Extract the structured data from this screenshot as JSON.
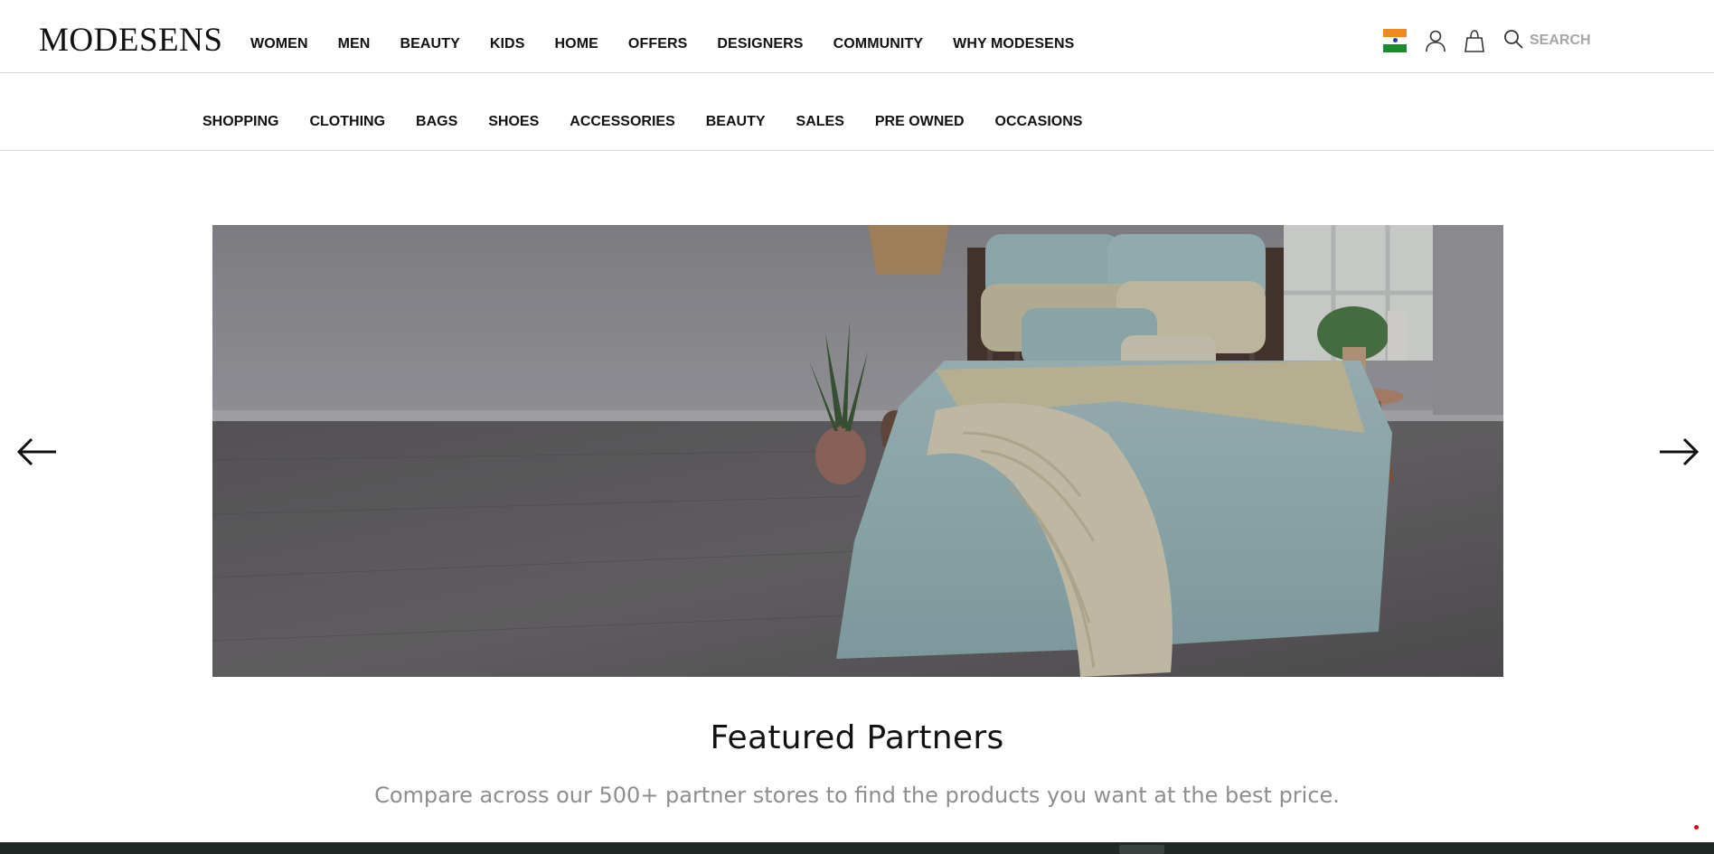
{
  "brand": {
    "logo": "MODESENS"
  },
  "main_nav": [
    {
      "label": "WOMEN"
    },
    {
      "label": "MEN"
    },
    {
      "label": "BEAUTY"
    },
    {
      "label": "KIDS"
    },
    {
      "label": "HOME"
    },
    {
      "label": "OFFERS"
    },
    {
      "label": "DESIGNERS"
    },
    {
      "label": "COMMUNITY"
    },
    {
      "label": "WHY MODESENS"
    }
  ],
  "utilities": {
    "country_flag_icon": "india-flag-icon",
    "account_icon": "user-icon",
    "bag_icon": "shopping-bag-icon",
    "search_icon": "search-icon",
    "search_placeholder": "SEARCH"
  },
  "sub_nav": [
    {
      "label": "SHOPPING"
    },
    {
      "label": "CLOTHING"
    },
    {
      "label": "BAGS"
    },
    {
      "label": "SHOES"
    },
    {
      "label": "ACCESSORIES"
    },
    {
      "label": "BEAUTY"
    },
    {
      "label": "SALES"
    },
    {
      "label": "PRE OWNED"
    },
    {
      "label": "OCCASIONS"
    }
  ],
  "hero": {
    "image": "bedroom-with-light-blue-bedding-banner",
    "prev_icon": "arrow-left-icon",
    "next_icon": "arrow-right-icon"
  },
  "featured": {
    "title": "Featured Partners",
    "subtitle": "Compare across our 500+ partner stores to find the products you want at the best price."
  },
  "colors": {
    "text": "#111111",
    "muted": "#8e8e8e",
    "border": "#d6d6d6",
    "bedding_blue": "#9fbcc0"
  }
}
